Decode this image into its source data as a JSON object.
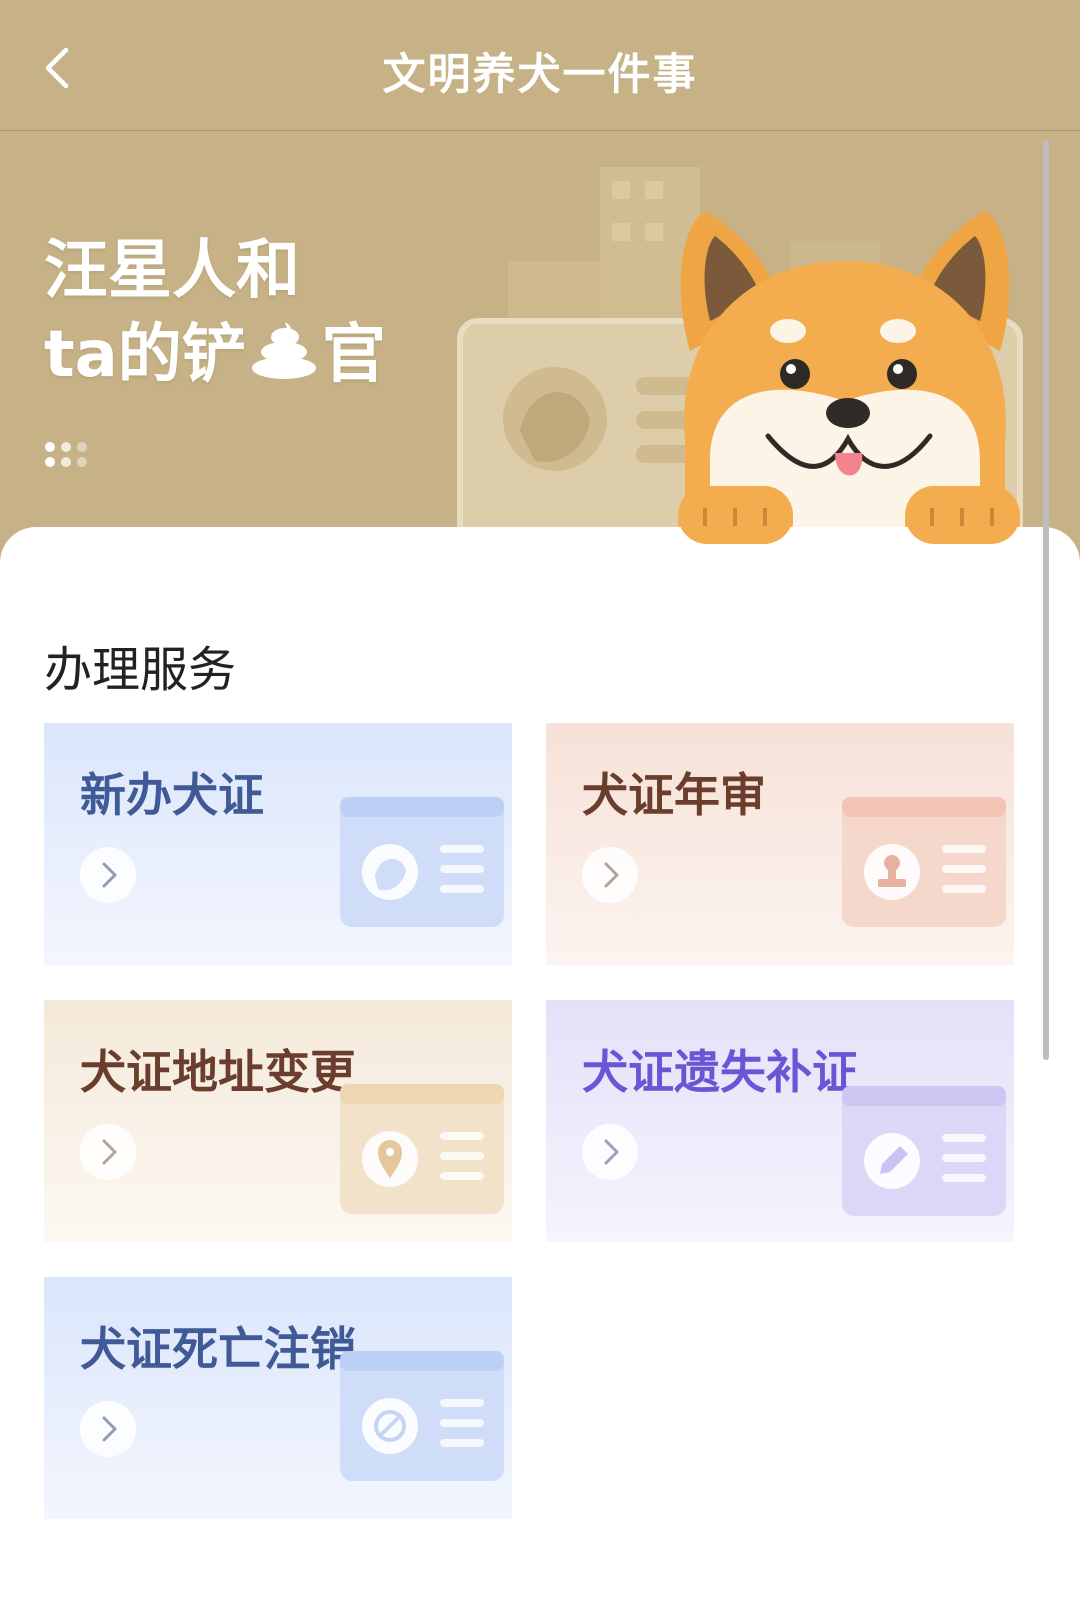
{
  "header": {
    "title": "文明养犬一件事",
    "back_icon": "chevron-left-icon"
  },
  "banner": {
    "line1": "汪星人和",
    "line2_prefix": "ta的铲",
    "line2_suffix": "官",
    "emoji_icon": "poop-icon",
    "mascot_icon": "shiba-dog-icon",
    "background_color": "#c6b286"
  },
  "services": {
    "title": "办理服务",
    "cards": [
      {
        "label": "新办犬证",
        "icon": "dog-avatar-icon",
        "color": "#3f5a97"
      },
      {
        "label": "犬证年审",
        "icon": "stamp-icon",
        "color": "#6b3d2c"
      },
      {
        "label": "犬证地址变更",
        "icon": "location-pin-icon",
        "color": "#6b3d2c"
      },
      {
        "label": "犬证遗失补证",
        "icon": "pencil-icon",
        "color": "#6a56d4"
      },
      {
        "label": "犬证死亡注销",
        "icon": "ban-icon",
        "color": "#3f5a97"
      }
    ]
  }
}
